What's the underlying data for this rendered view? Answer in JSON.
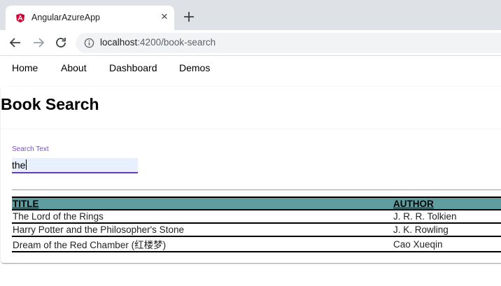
{
  "browser": {
    "tab_title": "AngularAzureApp",
    "tab_close": "×",
    "url_host": "localhost",
    "url_path": ":4200/book-search"
  },
  "nav": {
    "items": [
      "Home",
      "About",
      "Dashboard",
      "Demos"
    ]
  },
  "page": {
    "title": "Book Search",
    "search": {
      "label": "Search Text",
      "value": "the"
    }
  },
  "table": {
    "headers": {
      "title": "TITLE",
      "author": "AUTHOR"
    },
    "rows": [
      {
        "title": "The Lord of the Rings",
        "author": "J. R. R. Tolkien"
      },
      {
        "title": "Harry Potter and the Philosopher's Stone",
        "author": "J. K. Rowling"
      },
      {
        "title": "Dream of the Red Chamber (红楼梦)",
        "author": "Cao Xueqin"
      }
    ]
  },
  "colors": {
    "header_bg": "#5f9ea0",
    "field_accent": "#673ab7",
    "angular_red": "#dd0031"
  }
}
